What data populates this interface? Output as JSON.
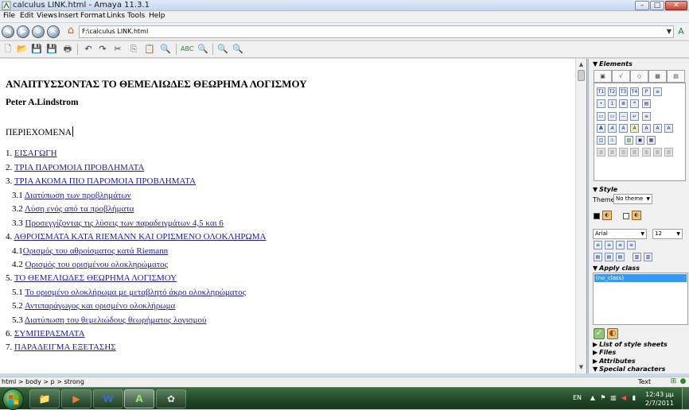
{
  "window": {
    "title": "calculus LINK.html - Amaya 11.3.1",
    "minimize_glyph": "–",
    "maximize_glyph": "□",
    "close_glyph": "✕"
  },
  "menu": [
    "File",
    "Edit",
    "Views",
    "Insert",
    "Format",
    "Links",
    "Tools",
    "Help"
  ],
  "address": {
    "url": "F:\\calculus LINK.html"
  },
  "document": {
    "title": "ΑΝΑΠΤΥΣΣΟΝΤΑΣ ΤΟ ΘΕΜΕΛΙΩΔΕΣ ΘΕΩΡΗΜΑ ΛΟΓΙΣΜΟΥ",
    "author": "Peter A.Lindstrom",
    "contents_heading": "ΠΕΡΙΕΧΟΜΕΝΑ",
    "toc": [
      {
        "num": "1. ",
        "text": "ΕΙΣΑΓΩΓΗ"
      },
      {
        "num": "2. ",
        "text": "ΤΡΙΑ ΠΑΡΟΜΟΙΑ ΠΡΟΒΛΗΜΑΤΑ"
      },
      {
        "num": "3. ",
        "text": "ΤΡΙΑ ΑΚΟΜΑ ΠΙΟ ΠΑΡΟΜΟΙΑ ΠΡΟΒΛΗΜΑΤΑ"
      },
      {
        "num": "3.1 ",
        "text": "Διατύπωση των προβλημάτων"
      },
      {
        "num": "3.2 ",
        "text": "Λύση ενός από τα προβλήματα"
      },
      {
        "num": "3.3 ",
        "text": "Προσεγγίζοντας τις λύσεις των παραδειγμάτων 4,5 και 6"
      },
      {
        "num": "4. ",
        "text": "ΑΘΡΟΙΣΜΑΤΑ ΚΑΤΑ RIEMANN ΚΑΙ ΟΡΙΣΜΕΝΟ ΟΛΟΚΛΗΡΩΜΑ"
      },
      {
        "num": "4.1",
        "text": "Ορισμός του αθροίσματος κατά Riemann"
      },
      {
        "num": "4.2 ",
        "text": "Ορισμός του ορισμένου ολοκληρώματος"
      },
      {
        "num": "5. ",
        "text": "ΤΟ ΘΕΜΕΛΙΩΔΕΣ ΘΕΩΡΗΜΑ ΛΟΓΙΣΜΟΥ"
      },
      {
        "num": "5.1 ",
        "text": "Το ορισμένο ολοκλήρωμα με μεταβλητό άκρο ολοκληρώματος"
      },
      {
        "num": "5.2 ",
        "text": "Αντιπαράγωγος και ορισμένο ολοκλήρωμα"
      },
      {
        "num": "5.3 ",
        "text": "Διατύπωση του θεμελιώδους θεωρήματος λογισμού"
      },
      {
        "num": "6. ",
        "text": "ΣΥΜΠΕΡΑΣΜΑΤΑ"
      },
      {
        "num": "7. ",
        "text": "ΠΑΡΑΔΕΙΓΜΑ ΕΞΕΤΑΣΗΣ"
      }
    ]
  },
  "panel": {
    "elements_label": "Elements",
    "style_label": "Style",
    "theme_label": "Theme",
    "theme_value": "No theme",
    "font_value": "Arial",
    "size_value": "12",
    "apply_class_label": "Apply class",
    "class_selected": "(no_class)",
    "collapsed_sections": [
      "List of style sheets",
      "Files",
      "Attributes",
      "Special characters"
    ]
  },
  "status": {
    "path": "html > body > p > strong",
    "mode": "Text"
  },
  "taskbar": {
    "lang": "EN",
    "time": "12:43 μμ",
    "date": "2/7/2011"
  },
  "colors": {
    "link": "#1a1aa6",
    "selection": "#3399ff",
    "taskbar": "#1f4526"
  }
}
